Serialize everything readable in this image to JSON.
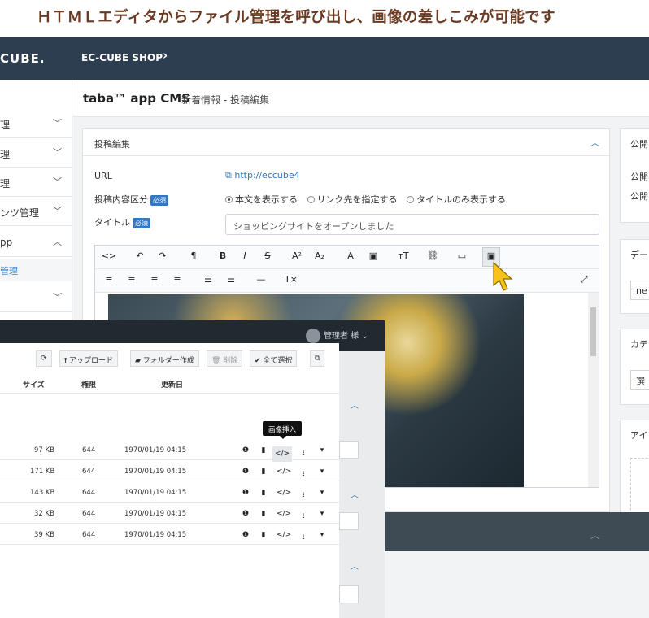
{
  "headline": "ＨＴＭＬエディタからファイル管理を呼び出し、画像の差しこみが可能です",
  "topbar": {
    "logo": "CUBE.",
    "shop": "EC-CUBE SHOP",
    "chevron": "›"
  },
  "sidebar": {
    "items": [
      {
        "label": "理",
        "icon": "﹀"
      },
      {
        "label": "理",
        "icon": "﹀"
      },
      {
        "label": "理",
        "icon": "﹀"
      },
      {
        "label": "ンツ管理",
        "icon": "﹀"
      },
      {
        "label": "pp",
        "icon": "︿"
      }
    ],
    "sub": "管理",
    "last_icon": "﹀"
  },
  "page": {
    "app": "taba™ app CMS",
    "subtitle": "新着情報 - 投稿編集"
  },
  "card": {
    "title": "投稿編集",
    "url_label": "URL",
    "url_value": "http://eccube4",
    "type_label": "投稿内容区分",
    "required": "必須",
    "radio_options": [
      "本文を表示する",
      "リンク先を指定する",
      "タイトルのみ表示する"
    ],
    "title_label": "タイトル",
    "title_value": "ショッピングサイトをオープンしました"
  },
  "right": {
    "publish": "公開",
    "publish_1": "公開",
    "publish_2": "公開",
    "date": "デー",
    "date_value": "ne",
    "category": "カテ",
    "category_value": "選",
    "icon": "アイ"
  },
  "filemanager": {
    "user": "管理者 様",
    "buttons": {
      "refresh": "⟳",
      "upload": "アップロード",
      "folder": "フォルダー作成",
      "delete": "削除",
      "select_all": "全て選択",
      "open": "⧉"
    },
    "columns": {
      "size": "サイズ",
      "perm": "権限",
      "date": "更新日"
    },
    "tooltip": "画像挿入",
    "rows": [
      {
        "size": "97 KB",
        "perm": "644",
        "date": "1970/01/19 04:15"
      },
      {
        "size": "171 KB",
        "perm": "644",
        "date": "1970/01/19 04:15"
      },
      {
        "size": "143 KB",
        "perm": "644",
        "date": "1970/01/19 04:15"
      },
      {
        "size": "32 KB",
        "perm": "644",
        "date": "1970/01/19 04:15"
      },
      {
        "size": "39 KB",
        "perm": "644",
        "date": "1970/01/19 04:15"
      }
    ]
  },
  "colors": {
    "header_bg": "#2c3e50",
    "accent": "#3478c5",
    "headline": "#6b3a23",
    "fm_bg": "#222a31"
  }
}
